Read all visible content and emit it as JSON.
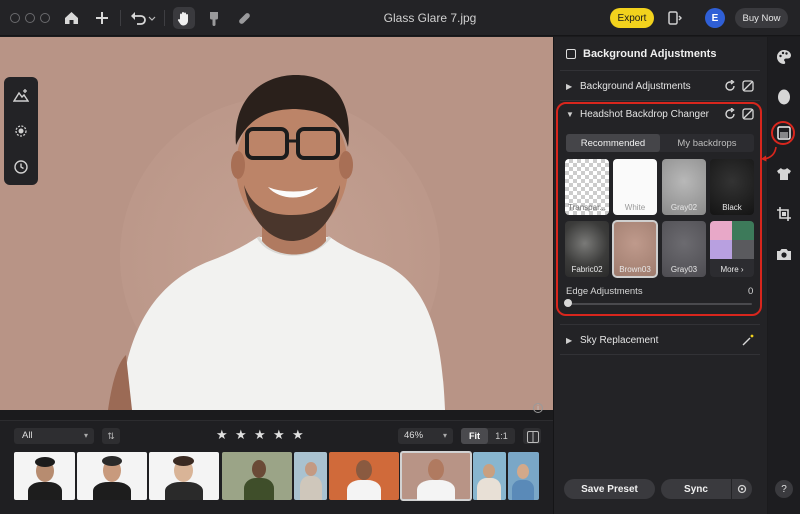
{
  "window": {
    "title": "Glass Glare 7.jpg"
  },
  "toolbar": {
    "export_label": "Export",
    "account_initial": "E",
    "buy_label": "Buy Now"
  },
  "filmstrip": {
    "filter_value": "All",
    "zoom_value": "46%",
    "fit_label": "Fit",
    "one_to_one_label": "1:1",
    "star_count": 5
  },
  "panel": {
    "header_title": "Background Adjustments",
    "sections": {
      "background": "Background Adjustments",
      "headshot": "Headshot Backdrop Changer",
      "sky": "Sky Replacement"
    },
    "tabs": [
      "Recommended",
      "My backdrops"
    ],
    "swatches": [
      {
        "label": "Transpar..."
      },
      {
        "label": "White"
      },
      {
        "label": "Gray02"
      },
      {
        "label": "Black"
      },
      {
        "label": "Fabric02"
      },
      {
        "label": "Brown03"
      },
      {
        "label": "Gray03"
      },
      {
        "label": "More ›"
      }
    ],
    "edge": {
      "label": "Edge Adjustments",
      "value": "0"
    },
    "save_preset_label": "Save Preset",
    "sync_label": "Sync"
  },
  "rail": {
    "help_label": "?"
  },
  "colors": {
    "accent_yellow": "#f2d21d",
    "highlight_red": "#d8261d",
    "avatar_blue": "#2f5fd6",
    "canvas_bg": "#b89486"
  }
}
